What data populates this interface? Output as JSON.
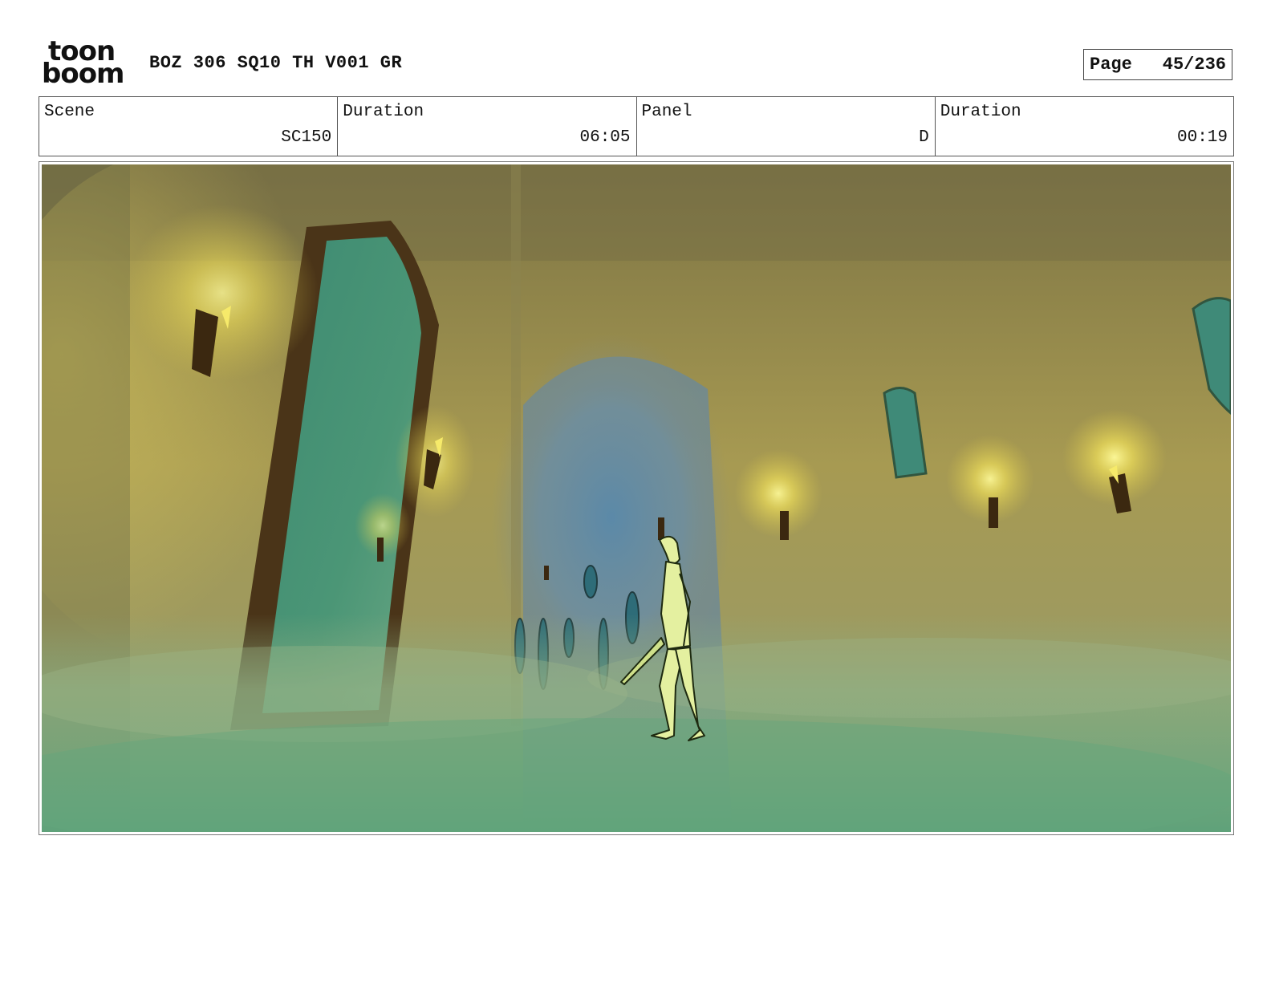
{
  "header": {
    "logo_text_line1": "toon",
    "logo_text_line2": "boom",
    "project_title": "BOZ 306 SQ10 TH V001 GR",
    "page_label": "Page",
    "page_value": "45/236"
  },
  "info": {
    "scene_label": "Scene",
    "scene_value": "SC150",
    "scene_duration_label": "Duration",
    "scene_duration_value": "06:05",
    "panel_label": "Panel",
    "panel_value": "D",
    "panel_duration_label": "Duration",
    "panel_duration_value": "00:19"
  },
  "colors": {
    "wall": "#a99a4a",
    "fog": "#7fae86",
    "door_glass": "#3f8a6e",
    "door_frame": "#4a3418",
    "torch_glow": "#fff36a",
    "corridor_blue": "#5d86a0",
    "character": "#e6f2a0"
  }
}
